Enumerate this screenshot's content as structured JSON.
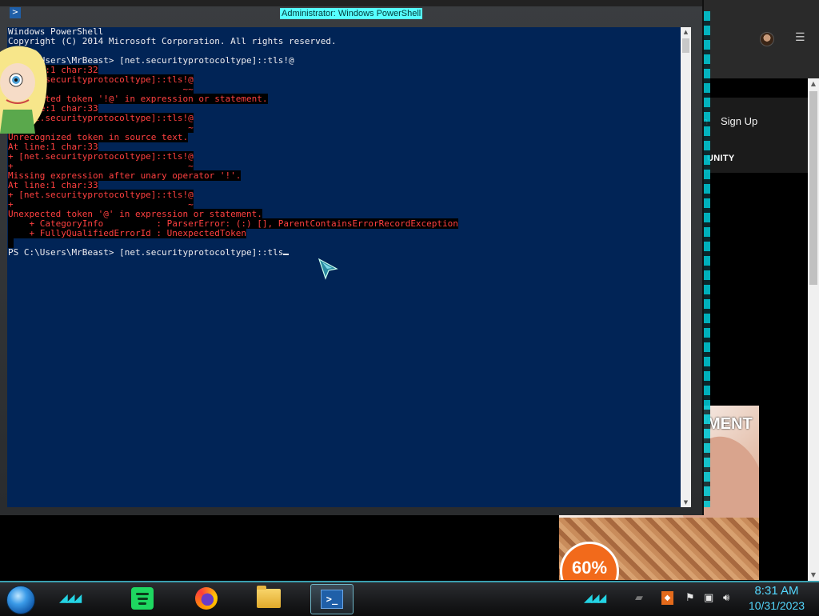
{
  "window": {
    "title": "Administrator: Windows PowerShell",
    "icon": "powershell-icon"
  },
  "console": {
    "lines": [
      {
        "text": "Windows PowerShell",
        "kind": "normal"
      },
      {
        "text": "Copyright (C) 2014 Microsoft Corporation. All rights reserved.",
        "kind": "normal"
      },
      {
        "text": "",
        "kind": "normal"
      },
      {
        "text": "PS C:\\Users\\MrBeast> [net.securityprotocoltype]::tls!@",
        "kind": "normal"
      },
      {
        "text": "At line:1 char:32",
        "kind": "error"
      },
      {
        "text": "+ [net.securityprotocoltype]::tls!@",
        "kind": "error"
      },
      {
        "text": "+                                ~~",
        "kind": "error"
      },
      {
        "text": "Unexpected token '!@' in expression or statement.",
        "kind": "error"
      },
      {
        "text": "At line:1 char:33",
        "kind": "error"
      },
      {
        "text": "+ [net.securityprotocoltype]::tls!@",
        "kind": "error"
      },
      {
        "text": "+                                 ~",
        "kind": "error"
      },
      {
        "text": "Unrecognized token in source text.",
        "kind": "error"
      },
      {
        "text": "At line:1 char:33",
        "kind": "error"
      },
      {
        "text": "+ [net.securityprotocoltype]::tls!@",
        "kind": "error"
      },
      {
        "text": "+                                 ~",
        "kind": "error"
      },
      {
        "text": "Missing expression after unary operator '!'.",
        "kind": "error"
      },
      {
        "text": "At line:1 char:33",
        "kind": "error"
      },
      {
        "text": "+ [net.securityprotocoltype]::tls!@",
        "kind": "error"
      },
      {
        "text": "+                                 ~",
        "kind": "error"
      },
      {
        "text": "Unexpected token '@' in expression or statement.",
        "kind": "error"
      },
      {
        "text": "    + CategoryInfo          : ParserError: (:) [], ParentContainsErrorRecordException",
        "kind": "error"
      },
      {
        "text": "    + FullyQualifiedErrorId : UnexpectedToken",
        "kind": "error"
      },
      {
        "text": " ",
        "kind": "error"
      },
      {
        "text": "PS C:\\Users\\MrBeast> [net.securityprotocoltype]::tls",
        "kind": "prompt"
      }
    ]
  },
  "browser": {
    "signup_label": "Sign Up",
    "login_fragment": "n",
    "community_label": "UNITY",
    "ad_text": "MENT",
    "ad_badge": "60%"
  },
  "taskbar": {
    "items": [
      {
        "name": "spotify-taskbar-button",
        "icon": "spotify-icon"
      },
      {
        "name": "firefox-taskbar-button",
        "icon": "firefox-icon"
      },
      {
        "name": "file-explorer-taskbar-button",
        "icon": "folder-icon"
      },
      {
        "name": "powershell-taskbar-button",
        "icon": "powershell-icon",
        "active": true
      }
    ],
    "tray_icons": [
      "app-tray-icon",
      "flag-icon",
      "network-icon",
      "volume-icon"
    ],
    "clock": {
      "time": "8:31 AM",
      "date": "10/31/2023"
    }
  },
  "colors": {
    "console_bg": "#012456",
    "console_fg": "#eeedf0",
    "error_fg": "#ff4040",
    "clock": "#54d8ff",
    "accent": "#24d4e4"
  }
}
